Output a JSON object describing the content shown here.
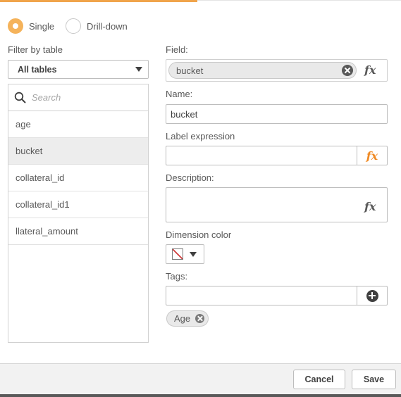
{
  "mode": {
    "options": [
      {
        "label": "Single",
        "selected": true
      },
      {
        "label": "Drill-down",
        "selected": false
      }
    ]
  },
  "filter": {
    "label": "Filter by table",
    "selected": "All tables"
  },
  "field_list": {
    "search_placeholder": "Search",
    "items": [
      {
        "label": "age",
        "selected": false
      },
      {
        "label": "bucket",
        "selected": true
      },
      {
        "label": "collateral_id",
        "selected": false
      },
      {
        "label": "collateral_id1",
        "selected": false
      },
      {
        "label": "llateral_amount",
        "selected": false
      }
    ]
  },
  "field": {
    "label": "Field:",
    "value": "bucket",
    "fx_icon": "fx"
  },
  "name": {
    "label": "Name:",
    "value": "bucket"
  },
  "label_expression": {
    "label": "Label expression",
    "value": "",
    "fx_icon": "fx"
  },
  "description": {
    "label": "Description:",
    "value": "",
    "fx_icon": "fx"
  },
  "dimension_color": {
    "label": "Dimension color",
    "value": "none"
  },
  "tags": {
    "label": "Tags:",
    "input_value": "",
    "items": [
      "Age"
    ]
  },
  "footer": {
    "cancel_label": "Cancel",
    "save_label": "Save"
  },
  "colors": {
    "accent": "#f5b35b",
    "fx_active": "#f08a24",
    "selected_row": "#ededed"
  }
}
